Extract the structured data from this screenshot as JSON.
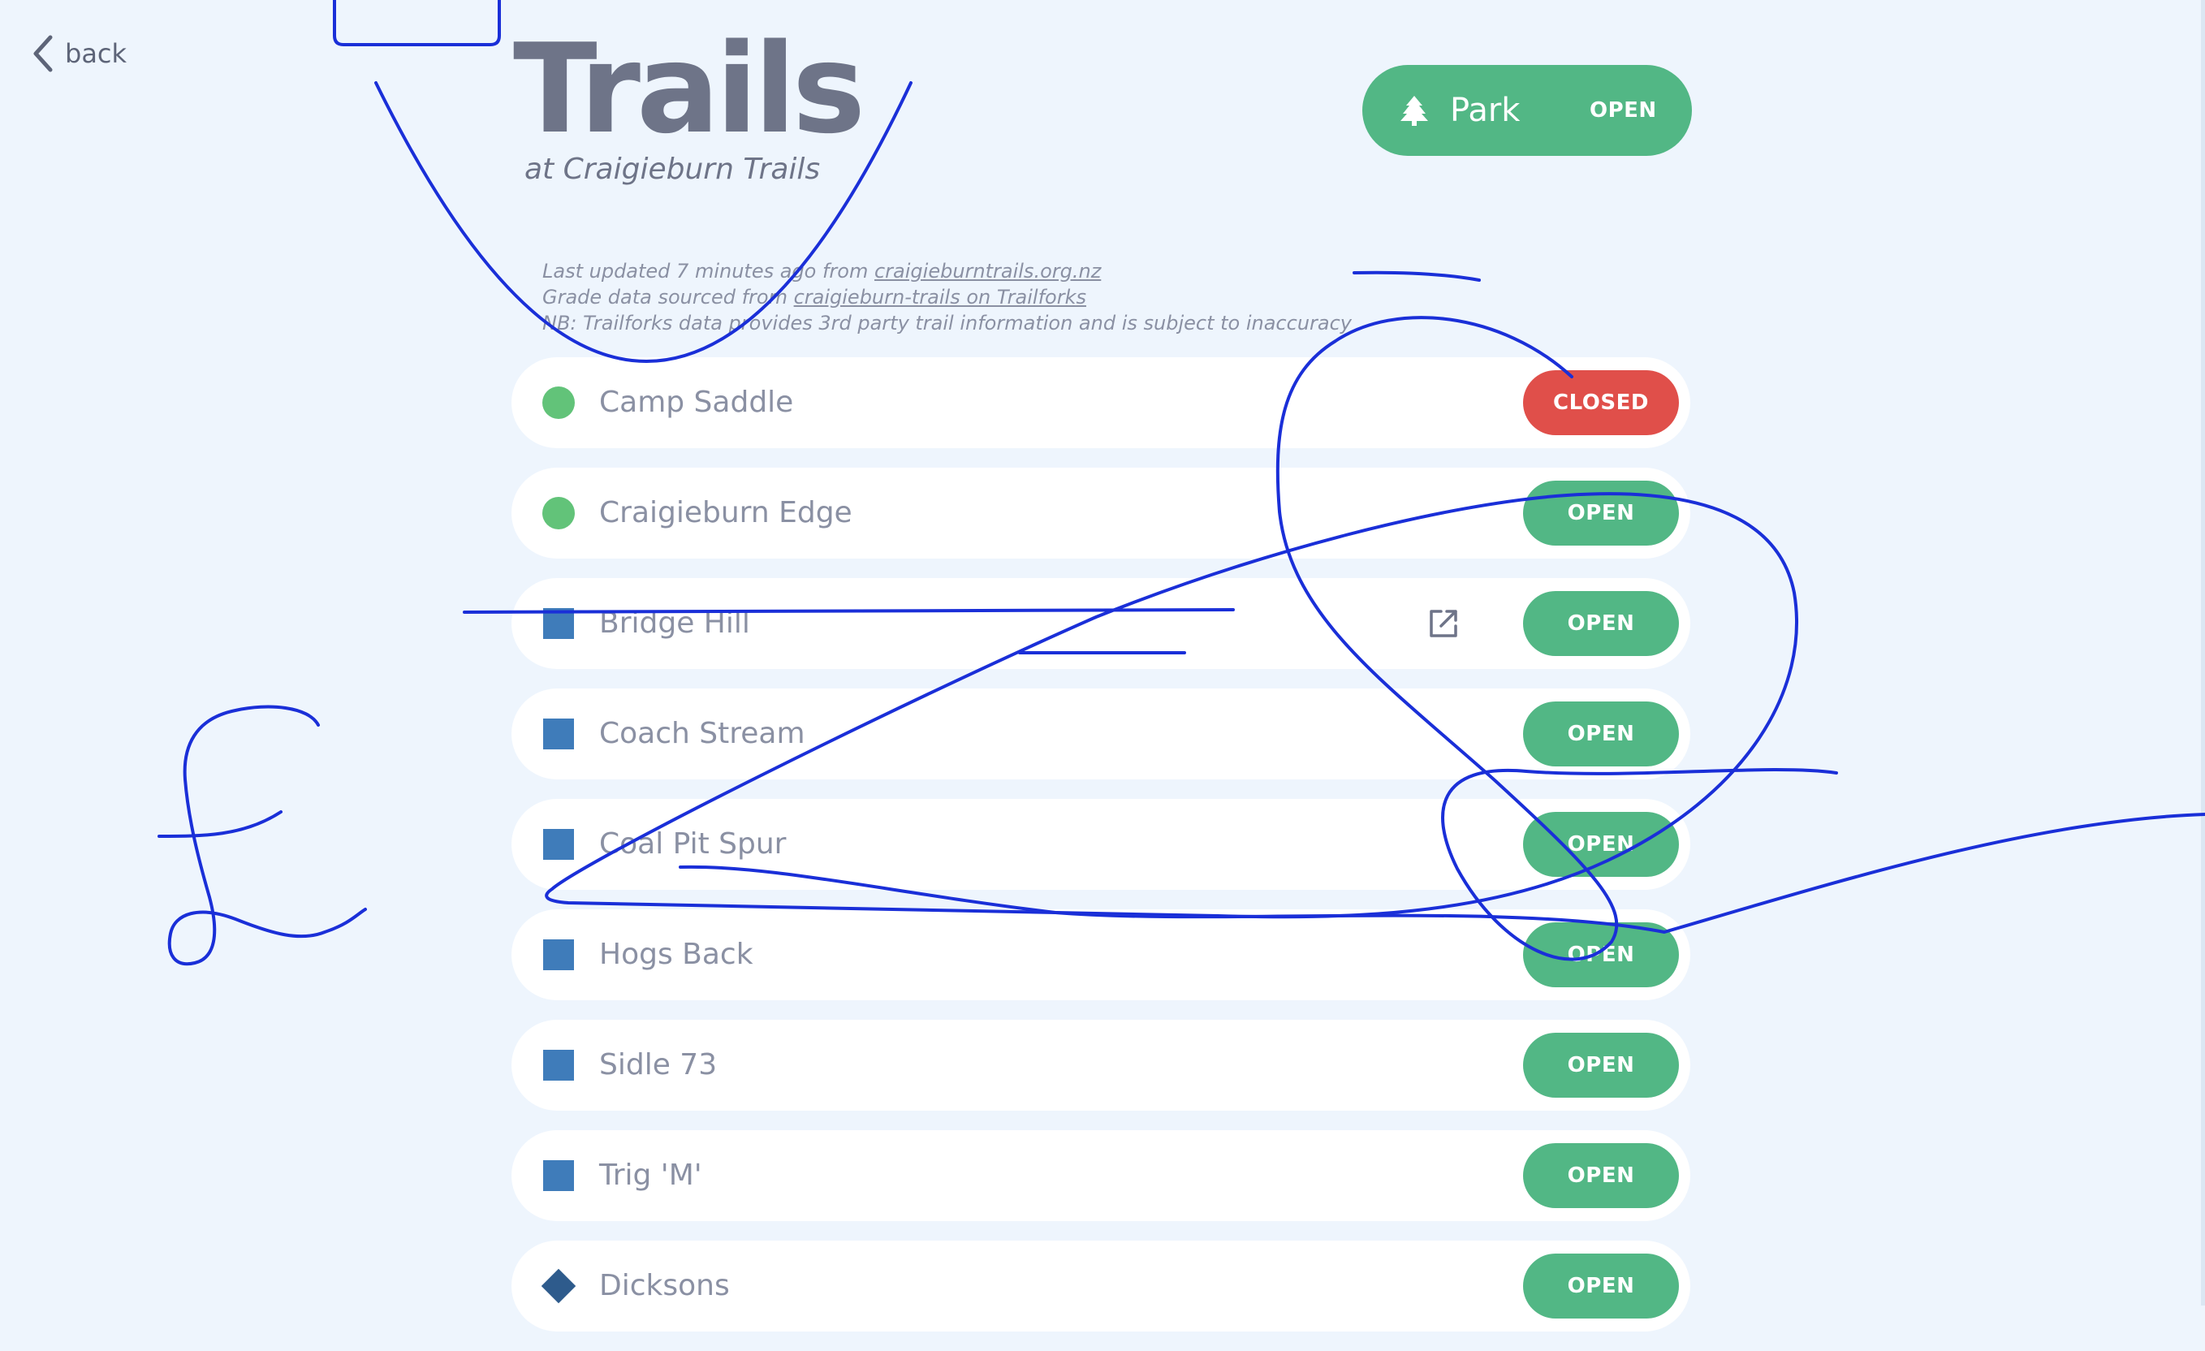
{
  "nav": {
    "back_label": "back"
  },
  "header": {
    "title": "Trails",
    "subtitle": "at Craigieburn Trails"
  },
  "park": {
    "label": "Park",
    "status": "OPEN",
    "icon": "tree-icon",
    "color": "#52b785"
  },
  "info": {
    "line1_prefix": "Last updated 7 minutes ago from ",
    "line1_link": "craigieburntrails.org.nz",
    "line2_prefix": "Grade data sourced from ",
    "line2_link": "craigieburn-trails on Trailforks",
    "line3": "NB: Trailforks data provides 3rd party trail information and is subject to inaccuracy"
  },
  "colors": {
    "open": "#52b785",
    "closed": "#e04f4a",
    "grade_easy": "#62c379",
    "grade_intermediate": "#3f7cba",
    "grade_advanced": "#2e5b8c",
    "annotation_ink": "#1a2fd8"
  },
  "trails": [
    {
      "name": "Camp Saddle",
      "grade": "circle",
      "status": "CLOSED"
    },
    {
      "name": "Craigieburn Edge",
      "grade": "circle",
      "status": "OPEN"
    },
    {
      "name": "Bridge Hill",
      "grade": "square",
      "status": "OPEN",
      "external_link_icon": "external-link-icon"
    },
    {
      "name": "Coach Stream",
      "grade": "square",
      "status": "OPEN"
    },
    {
      "name": "Coal Pit Spur",
      "grade": "square",
      "status": "OPEN"
    },
    {
      "name": "Hogs Back",
      "grade": "square",
      "status": "OPEN"
    },
    {
      "name": "Sidle 73",
      "grade": "square",
      "status": "OPEN"
    },
    {
      "name": "Trig 'M'",
      "grade": "square",
      "status": "OPEN"
    },
    {
      "name": "Dicksons",
      "grade": "diamond",
      "status": "OPEN"
    }
  ]
}
